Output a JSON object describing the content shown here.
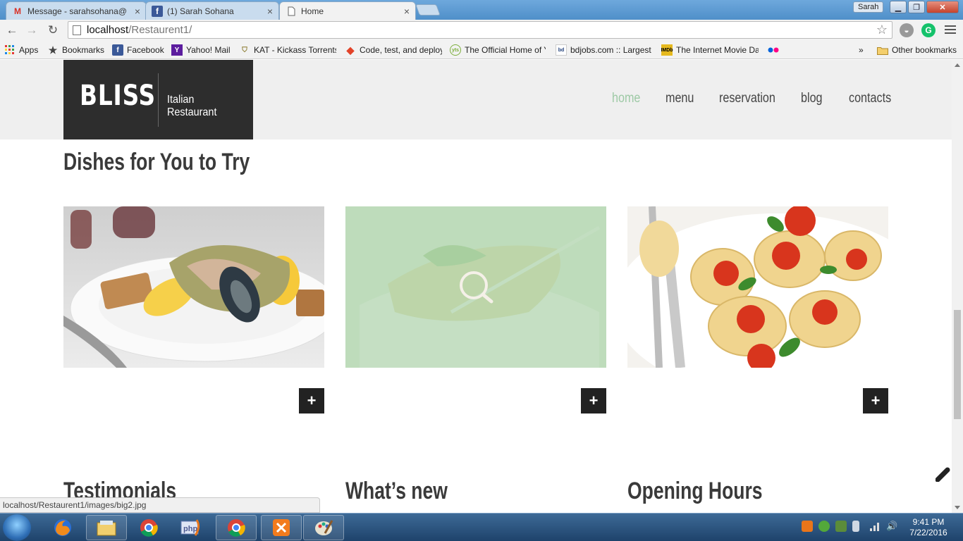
{
  "browser": {
    "tabs": [
      {
        "label": "Message - sarahsohana@",
        "icon": "gmail-icon"
      },
      {
        "label": "(1) Sarah Sohana",
        "icon": "facebook-icon"
      },
      {
        "label": "Home",
        "icon": "page-icon"
      }
    ],
    "user_name": "Sarah",
    "url_host": "localhost",
    "url_path": "/Restaurent1/",
    "bookmarks": [
      {
        "label": "Apps",
        "icon": "apps-grid-icon"
      },
      {
        "label": "Bookmarks",
        "icon": "star-icon"
      },
      {
        "label": "Facebook",
        "icon": "facebook-icon"
      },
      {
        "label": "Yahoo! Mail",
        "icon": "yahoo-icon"
      },
      {
        "label": "KAT - Kickass Torrents",
        "icon": "kat-icon"
      },
      {
        "label": "Code, test, and deploy",
        "icon": "gitlab-icon"
      },
      {
        "label": "The Official Home of Y",
        "icon": "yts-icon"
      },
      {
        "label": "bdjobs.com :: Largest",
        "icon": "bdjobs-icon"
      },
      {
        "label": "The Internet Movie Da",
        "icon": "imdb-icon"
      }
    ],
    "overflow_label": "»",
    "other_bookmarks": "Other bookmarks",
    "status_url": "localhost/Restaurent1/images/big2.jpg"
  },
  "site": {
    "brand": "BLISS",
    "tagline": "Italian Restaurant",
    "nav": [
      {
        "label": "home",
        "active": true
      },
      {
        "label": "menu",
        "active": false
      },
      {
        "label": "reservation",
        "active": false
      },
      {
        "label": "blog",
        "active": false
      },
      {
        "label": "contacts",
        "active": false
      }
    ],
    "dishes_title": "Dishes for You to Try",
    "plus_label": "+",
    "bottom_sections": [
      "Testimonials",
      "What’s new",
      "Opening Hours"
    ]
  },
  "taskbar": {
    "time": "9:41 PM",
    "date": "7/22/2016"
  },
  "colors": {
    "nav_active": "#9dc9a5",
    "logo_bg": "#2d2d2d",
    "header_bg": "#efefef",
    "hover_overlay": "#a8d4b0"
  }
}
